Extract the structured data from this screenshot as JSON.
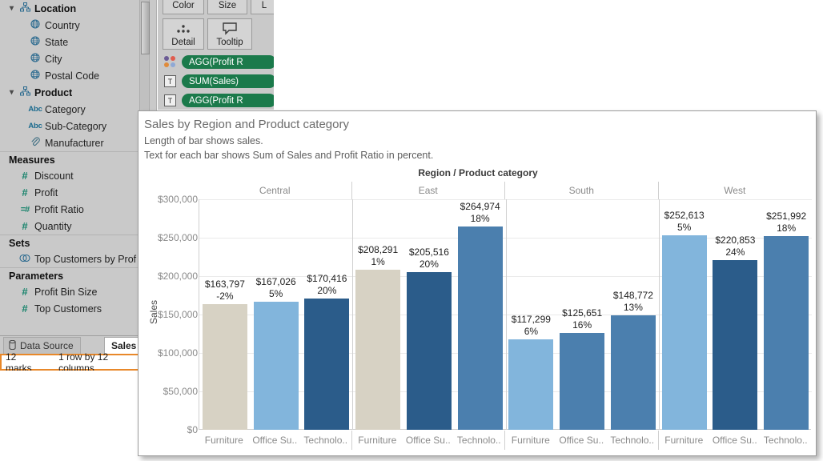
{
  "sidebar": {
    "groups": [
      {
        "label": "Location",
        "icon": "hierarchy-icon",
        "expanded": true,
        "children": [
          {
            "label": "Country",
            "icon": "globe-icon"
          },
          {
            "label": "State",
            "icon": "globe-icon"
          },
          {
            "label": "City",
            "icon": "globe-icon"
          },
          {
            "label": "Postal Code",
            "icon": "globe-icon"
          }
        ]
      },
      {
        "label": "Product",
        "icon": "hierarchy-icon",
        "expanded": true,
        "children": [
          {
            "label": "Category",
            "icon": "abc-icon"
          },
          {
            "label": "Sub-Category",
            "icon": "abc-icon"
          },
          {
            "label": "Manufacturer",
            "icon": "paperclip-icon"
          }
        ]
      }
    ],
    "sections": [
      {
        "header": "Measures",
        "items": [
          {
            "label": "Discount",
            "icon": "number-icon"
          },
          {
            "label": "Profit",
            "icon": "number-icon"
          },
          {
            "label": "Profit Ratio",
            "icon": "calculated-number-icon"
          },
          {
            "label": "Quantity",
            "icon": "number-icon"
          }
        ]
      },
      {
        "header": "Sets",
        "items": [
          {
            "label": "Top Customers by Prof",
            "icon": "set-icon"
          }
        ]
      },
      {
        "header": "Parameters",
        "items": [
          {
            "label": "Profit Bin Size",
            "icon": "number-icon"
          },
          {
            "label": "Top Customers",
            "icon": "number-icon"
          }
        ]
      }
    ]
  },
  "marks_card": {
    "buttons": [
      {
        "label": "Color",
        "icon": "color-icon"
      },
      {
        "label": "Size",
        "icon": "size-icon"
      },
      {
        "label": "L",
        "icon": "label-icon"
      },
      {
        "label": "Detail",
        "icon": "detail-icon"
      },
      {
        "label": "Tooltip",
        "icon": "tooltip-icon"
      }
    ],
    "pills": [
      {
        "label": "AGG(Profit R",
        "icon": "color-swatch-icon"
      },
      {
        "label": "SUM(Sales)",
        "icon": "text-icon"
      },
      {
        "label": "AGG(Profit R",
        "icon": "text-icon"
      }
    ]
  },
  "tabs": {
    "data_source": "Data Source",
    "data_source_icon": "database-icon",
    "sheet": "Sales"
  },
  "status_bar": {
    "marks": "12 marks",
    "dimensions": "1 row by 12 columns",
    "highlight_color": "#e8882a"
  },
  "viz": {
    "title": "Sales by Region and Product category",
    "subtitle_1": "Length of bar shows sales.",
    "subtitle_2": "Text for each bar shows Sum of Sales and Profit Ratio in percent."
  },
  "chart_data": {
    "type": "bar",
    "title": "Sales by Region and Product category",
    "column_field_label": "Region / Product category",
    "ylabel": "Sales",
    "xlabel": "",
    "ylim": [
      0,
      300000
    ],
    "yticks": [
      "$0",
      "$50,000",
      "$100,000",
      "$150,000",
      "$200,000",
      "$250,000",
      "$300,000"
    ],
    "ytick_values": [
      0,
      50000,
      100000,
      150000,
      200000,
      250000,
      300000
    ],
    "grid": true,
    "legend": "none",
    "categories": [
      "Furniture",
      "Office Supplies",
      "Technology"
    ],
    "category_labels": [
      "Furniture",
      "Office Su..",
      "Technolo.."
    ],
    "regions": [
      "Central",
      "East",
      "South",
      "West"
    ],
    "bars": [
      {
        "region": "Central",
        "category": "Furniture",
        "value": 163797,
        "value_label": "$163,797",
        "profit_ratio": -2,
        "profit_label": "-2%",
        "color": "#d7d2c4"
      },
      {
        "region": "Central",
        "category": "Office Supplies",
        "value": 167026,
        "value_label": "$167,026",
        "profit_ratio": 5,
        "profit_label": "5%",
        "color": "#82b5dc"
      },
      {
        "region": "Central",
        "category": "Technology",
        "value": 170416,
        "value_label": "$170,416",
        "profit_ratio": 20,
        "profit_label": "20%",
        "color": "#2b5c8a"
      },
      {
        "region": "East",
        "category": "Furniture",
        "value": 208291,
        "value_label": "$208,291",
        "profit_ratio": 1,
        "profit_label": "1%",
        "color": "#d7d2c4"
      },
      {
        "region": "East",
        "category": "Office Supplies",
        "value": 205516,
        "value_label": "$205,516",
        "profit_ratio": 20,
        "profit_label": "20%",
        "color": "#2b5c8a"
      },
      {
        "region": "East",
        "category": "Technology",
        "value": 264974,
        "value_label": "$264,974",
        "profit_ratio": 18,
        "profit_label": "18%",
        "color": "#4b7fae"
      },
      {
        "region": "South",
        "category": "Furniture",
        "value": 117299,
        "value_label": "$117,299",
        "profit_ratio": 6,
        "profit_label": "6%",
        "color": "#82b5dc"
      },
      {
        "region": "South",
        "category": "Office Supplies",
        "value": 125651,
        "value_label": "$125,651",
        "profit_ratio": 16,
        "profit_label": "16%",
        "color": "#4b7fae"
      },
      {
        "region": "South",
        "category": "Technology",
        "value": 148772,
        "value_label": "$148,772",
        "profit_ratio": 13,
        "profit_label": "13%",
        "color": "#4b7fae"
      },
      {
        "region": "West",
        "category": "Furniture",
        "value": 252613,
        "value_label": "$252,613",
        "profit_ratio": 5,
        "profit_label": "5%",
        "color": "#82b5dc"
      },
      {
        "region": "West",
        "category": "Office Supplies",
        "value": 220853,
        "value_label": "$220,853",
        "profit_ratio": 24,
        "profit_label": "24%",
        "color": "#2b5c8a"
      },
      {
        "region": "West",
        "category": "Technology",
        "value": 251992,
        "value_label": "$251,992",
        "profit_ratio": 18,
        "profit_label": "18%",
        "color": "#4b7fae"
      }
    ]
  }
}
